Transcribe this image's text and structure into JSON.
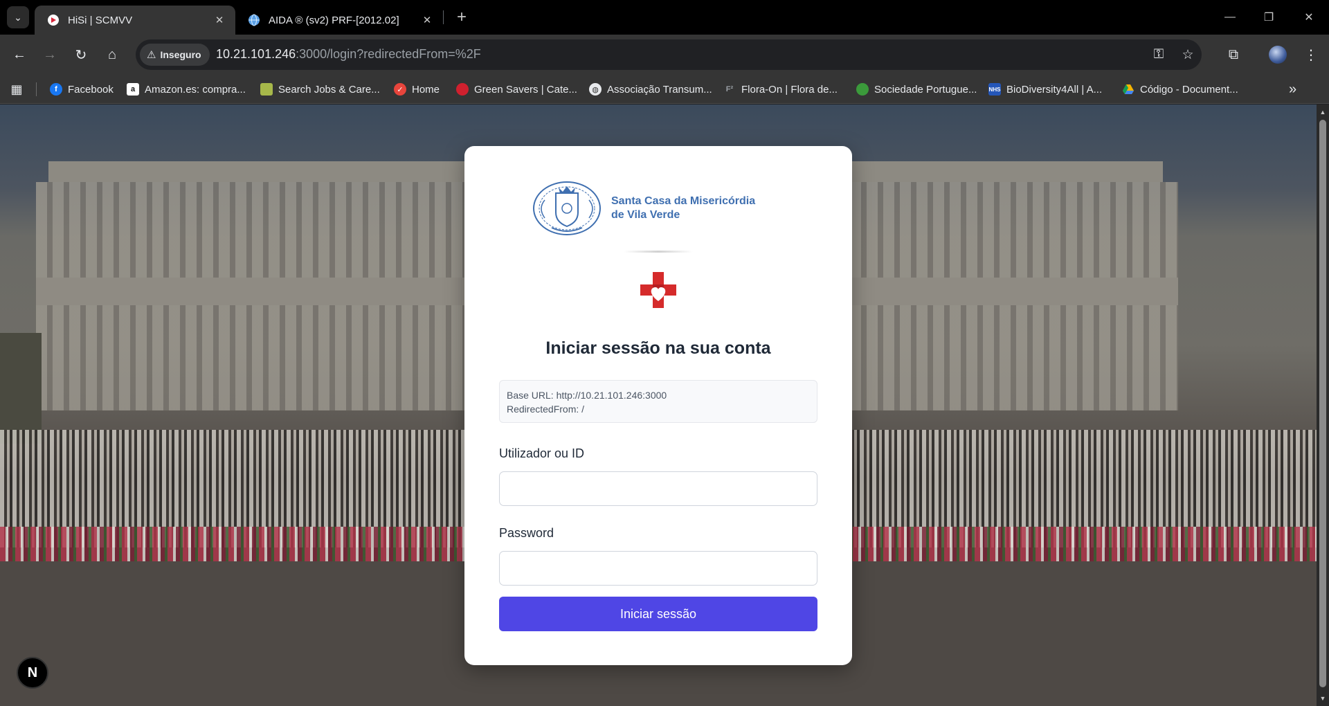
{
  "browser": {
    "tabs": [
      {
        "title": "HiSi | SCMVV",
        "active": true
      },
      {
        "title": "AIDA ® (sv2) PRF-[2012.02]",
        "active": false
      }
    ],
    "insecure_label": "Inseguro",
    "url_host": "10.21.101.246",
    "url_rest": ":3000/login?redirectedFrom=%2F",
    "bookmarks": [
      {
        "label": "Facebook",
        "icon": "facebook-icon",
        "color": "#1877f2"
      },
      {
        "label": "Amazon.es: compra...",
        "icon": "amazon-icon",
        "color": "#ffffff"
      },
      {
        "label": "Search Jobs & Care...",
        "icon": "jobs-icon",
        "color": "#a7b84a"
      },
      {
        "label": "Home",
        "icon": "home-bookmark-icon",
        "color": "#e8453c"
      },
      {
        "label": "Green Savers | Cate...",
        "icon": "green-savers-icon",
        "color": "#d0202e"
      },
      {
        "label": "Associação Transum...",
        "icon": "globe-icon",
        "color": "#e8eaed"
      },
      {
        "label": "Flora-On | Flora de...",
        "icon": "flora-icon",
        "color": "#9aa0a6"
      },
      {
        "label": "Sociedade Portugue...",
        "icon": "spea-icon",
        "color": "#3b9a3b"
      },
      {
        "label": "BioDiversity4All | A...",
        "icon": "nhs-icon",
        "color": "#2456b8"
      },
      {
        "label": "Código - Document...",
        "icon": "drive-icon",
        "color": "#f4b400"
      }
    ]
  },
  "login": {
    "org_name_line1": "Santa Casa da Misericórdia",
    "org_name_line2": "de Vila Verde",
    "title": "Iniciar sessão na sua conta",
    "base_url": "Base URL: http://10.21.101.246:3000",
    "redirected_from": "RedirectedFrom: /",
    "username_label": "Utilizador ou ID",
    "username_value": "",
    "password_label": "Password",
    "password_value": "",
    "submit_label": "Iniciar sessão",
    "accent_color": "#4f46e5",
    "brand_color": "#3f6fb0"
  },
  "overlay": {
    "next_badge": "N"
  }
}
